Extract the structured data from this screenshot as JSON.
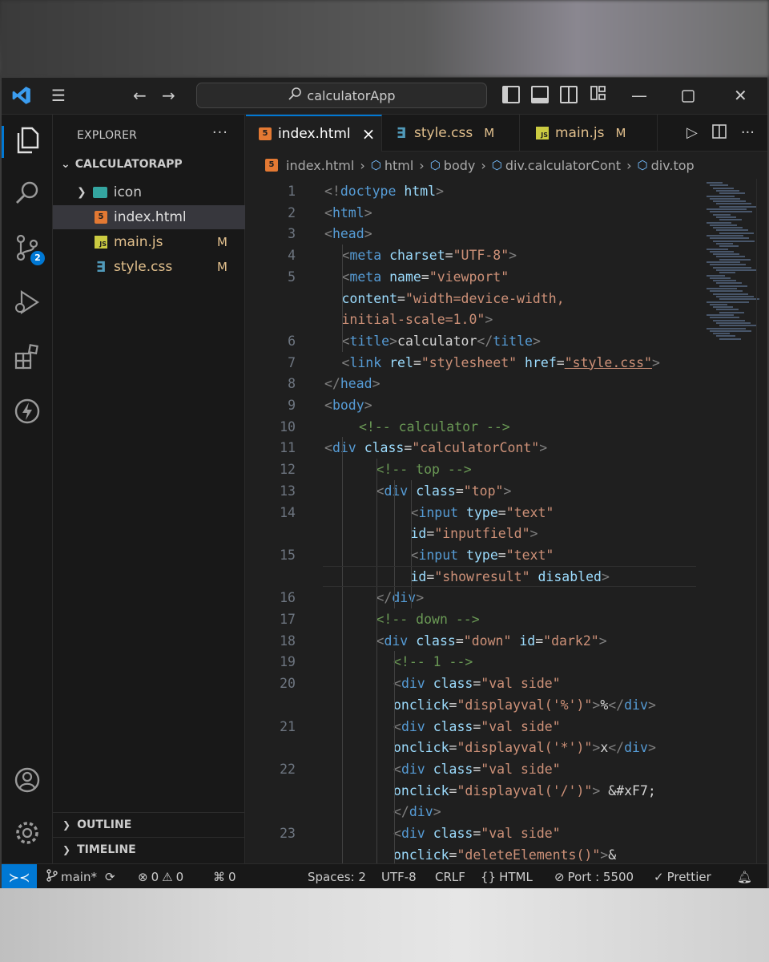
{
  "titlebar": {
    "search_text": "calculatorApp"
  },
  "sidebar": {
    "title": "EXPLORER",
    "more": "···",
    "root": "CALCULATORAPP",
    "items": [
      {
        "name": "icon",
        "type": "folder",
        "modified": ""
      },
      {
        "name": "index.html",
        "type": "html",
        "modified": ""
      },
      {
        "name": "main.js",
        "type": "js",
        "modified": "M"
      },
      {
        "name": "style.css",
        "type": "css",
        "modified": "M"
      }
    ],
    "outline": "OUTLINE",
    "timeline": "TIMELINE"
  },
  "activity": {
    "scm_badge": "2"
  },
  "tabs": [
    {
      "label": "index.html",
      "modified": "",
      "close": "×"
    },
    {
      "label": "style.css",
      "modified": "M"
    },
    {
      "label": "main.js",
      "modified": "M"
    }
  ],
  "breadcrumb": [
    "index.html",
    "html",
    "body",
    "div.calculatorCont",
    "div.top"
  ],
  "code_lines": [
    {
      "n": "1",
      "indent": 0,
      "html": "<span class='bracket'>&lt;!</span><span class='tag'>doctype</span> <span class='attr'>html</span><span class='bracket'>&gt;</span>"
    },
    {
      "n": "2",
      "indent": 0,
      "html": "<span class='bracket'>&lt;</span><span class='tag'>html</span><span class='bracket'>&gt;</span>"
    },
    {
      "n": "3",
      "indent": 0,
      "html": "<span class='bracket'>&lt;</span><span class='tag'>head</span><span class='bracket'>&gt;</span>"
    },
    {
      "n": "4",
      "indent": 1,
      "html": "<span class='bracket'>&lt;</span><span class='tag'>meta</span> <span class='attr'>charset</span><span class='plain'>=</span><span class='str'>\"UTF-8\"</span><span class='bracket'>&gt;</span>"
    },
    {
      "n": "5",
      "indent": 1,
      "html": "<span class='bracket'>&lt;</span><span class='tag'>meta</span> <span class='attr'>name</span><span class='plain'>=</span><span class='str'>\"viewport\"</span>"
    },
    {
      "n": "",
      "indent": 1,
      "html": "<span class='attr'>content</span><span class='plain'>=</span><span class='str'>\"width=device-width,</span>"
    },
    {
      "n": "",
      "indent": 1,
      "html": "<span class='str'>initial-scale=1.0\"</span><span class='bracket'>&gt;</span>"
    },
    {
      "n": "6",
      "indent": 1,
      "html": "<span class='bracket'>&lt;</span><span class='tag'>title</span><span class='bracket'>&gt;</span><span class='plain'>calculator</span><span class='bracket'>&lt;/</span><span class='tag'>title</span><span class='bracket'>&gt;</span>"
    },
    {
      "n": "7",
      "indent": 1,
      "html": "<span class='bracket'>&lt;</span><span class='tag'>link</span> <span class='attr'>rel</span><span class='plain'>=</span><span class='str'>\"stylesheet\"</span> <span class='attr'>href</span><span class='plain'>=</span><span class='str' style='text-decoration: underline;'>\"style.css\"</span><span class='bracket'>&gt;</span>"
    },
    {
      "n": "8",
      "indent": 0,
      "html": "<span class='bracket'>&lt;/</span><span class='tag'>head</span><span class='bracket'>&gt;</span>"
    },
    {
      "n": "9",
      "indent": 0,
      "html": "<span class='bracket'>&lt;</span><span class='tag'>body</span><span class='bracket'>&gt;</span>"
    },
    {
      "n": "10",
      "indent": 2,
      "html": "<span class='comment'>&lt;!-- calculator --&gt;</span>"
    },
    {
      "n": "11",
      "indent": 0,
      "html": "<span class='bracket'>&lt;</span><span class='tag'>div</span> <span class='attr'>class</span><span class='plain'>=</span><span class='str'>\"calculatorCont\"</span><span class='bracket'>&gt;</span>"
    },
    {
      "n": "12",
      "indent": 3,
      "html": "<span class='comment'>&lt;!-- top --&gt;</span>"
    },
    {
      "n": "13",
      "indent": 3,
      "html": "<span class='bracket'>&lt;</span><span class='tag'>div</span> <span class='attr'>class</span><span class='plain'>=</span><span class='str'>\"top\"</span><span class='bracket'>&gt;</span>"
    },
    {
      "n": "14",
      "indent": 5,
      "html": "<span class='bracket'>&lt;</span><span class='tag'>input</span> <span class='attr'>type</span><span class='plain'>=</span><span class='str'>\"text\"</span>"
    },
    {
      "n": "",
      "indent": 5,
      "html": "<span class='attr'>id</span><span class='plain'>=</span><span class='str'>\"inputfield\"</span><span class='bracket'>&gt;</span>"
    },
    {
      "n": "15",
      "indent": 5,
      "html": "<span class='bracket'>&lt;</span><span class='tag'>input</span> <span class='attr'>type</span><span class='plain'>=</span><span class='str'>\"text\"</span>"
    },
    {
      "n": "",
      "indent": 5,
      "html": "<span class='attr'>id</span><span class='plain'>=</span><span class='str'>\"showresult\"</span> <span class='attr'>disabled</span><span class='bracket'>&gt;</span>"
    },
    {
      "n": "16",
      "indent": 3,
      "html": "<span class='bracket'>&lt;/</span><span class='tag'>div</span><span class='bracket'>&gt;</span>"
    },
    {
      "n": "17",
      "indent": 3,
      "html": "<span class='comment'>&lt;!-- down --&gt;</span>"
    },
    {
      "n": "18",
      "indent": 3,
      "html": "<span class='bracket'>&lt;</span><span class='tag'>div</span> <span class='attr'>class</span><span class='plain'>=</span><span class='str'>\"down\"</span> <span class='attr'>id</span><span class='plain'>=</span><span class='str'>\"dark2\"</span><span class='bracket'>&gt;</span>"
    },
    {
      "n": "19",
      "indent": 4,
      "html": "<span class='comment'>&lt;!-- 1 --&gt;</span>"
    },
    {
      "n": "20",
      "indent": 4,
      "html": "<span class='bracket'>&lt;</span><span class='tag'>div</span> <span class='attr'>class</span><span class='plain'>=</span><span class='str'>\"val side\"</span>"
    },
    {
      "n": "",
      "indent": 4,
      "html": "<span class='attr'>onclick</span><span class='plain'>=</span><span class='str'>\"displayval('%')\"</span><span class='bracket'>&gt;</span><span class='plain'>%</span><span class='bracket'>&lt;/</span><span class='tag'>div</span><span class='bracket'>&gt;</span>"
    },
    {
      "n": "21",
      "indent": 4,
      "html": "<span class='bracket'>&lt;</span><span class='tag'>div</span> <span class='attr'>class</span><span class='plain'>=</span><span class='str'>\"val side\"</span>"
    },
    {
      "n": "",
      "indent": 4,
      "html": "<span class='attr'>onclick</span><span class='plain'>=</span><span class='str'>\"displayval('*')\"</span><span class='bracket'>&gt;</span><span class='plain'>x</span><span class='bracket'>&lt;/</span><span class='tag'>div</span><span class='bracket'>&gt;</span>"
    },
    {
      "n": "22",
      "indent": 4,
      "html": "<span class='bracket'>&lt;</span><span class='tag'>div</span> <span class='attr'>class</span><span class='plain'>=</span><span class='str'>\"val side\"</span>"
    },
    {
      "n": "",
      "indent": 4,
      "html": "<span class='attr'>onclick</span><span class='plain'>=</span><span class='str'>\"displayval('/')\"</span><span class='bracket'>&gt;</span><span class='plain'> &amp;#xF7;</span>"
    },
    {
      "n": "",
      "indent": 4,
      "html": "<span class='bracket'>&lt;/</span><span class='tag'>div</span><span class='bracket'>&gt;</span>"
    },
    {
      "n": "23",
      "indent": 4,
      "html": "<span class='bracket'>&lt;</span><span class='tag'>div</span> <span class='attr'>class</span><span class='plain'>=</span><span class='str'>\"val side\"</span>"
    },
    {
      "n": "",
      "indent": 4,
      "html": "<span class='attr'>onclick</span><span class='plain'>=</span><span class='str'>\"deleteElements()\"</span><span class='bracket'>&gt;</span><span class='plain'>&amp;</span>"
    }
  ],
  "statusbar": {
    "branch": "main*",
    "errors": "0",
    "warnings": "0",
    "ports": "0",
    "spaces": "Spaces: 2",
    "encoding": "UTF-8",
    "eol": "CRLF",
    "language": "HTML",
    "port": "Port : 5500",
    "prettier": "Prettier"
  },
  "colors": {
    "accent": "#0078d4",
    "bg": "#1f1f1f",
    "sidebar": "#181818"
  }
}
